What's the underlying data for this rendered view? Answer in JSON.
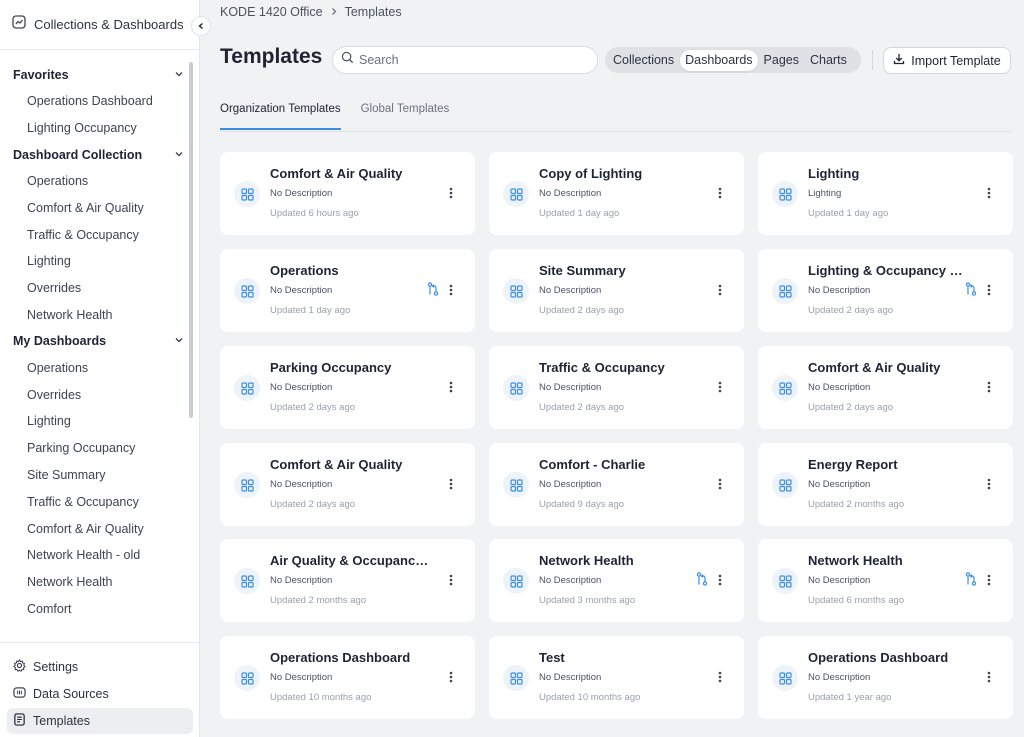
{
  "app": {
    "title": "Collections & Dashboards"
  },
  "sidebar": {
    "sections": [
      {
        "title": "Favorites",
        "items": [
          "Operations Dashboard",
          "Lighting Occupancy"
        ]
      },
      {
        "title": "Dashboard Collection",
        "items": [
          "Operations",
          "Comfort & Air Quality",
          "Traffic & Occupancy",
          "Lighting",
          "Overrides",
          "Network Health"
        ]
      },
      {
        "title": "My Dashboards",
        "items": [
          "Operations",
          "Overrides",
          "Lighting",
          "Parking Occupancy",
          "Site Summary",
          "Traffic & Occupancy",
          "Comfort & Air Quality",
          "Network Health - old",
          "Network Health",
          "Comfort"
        ]
      }
    ],
    "bottom": [
      {
        "label": "Settings",
        "icon": "gear-icon"
      },
      {
        "label": "Data Sources",
        "icon": "data-sources-icon"
      },
      {
        "label": "Templates",
        "icon": "templates-icon",
        "active": true
      }
    ]
  },
  "breadcrumb": [
    "KODE 1420 Office",
    "Templates"
  ],
  "page": {
    "title": "Templates"
  },
  "search": {
    "placeholder": "Search",
    "value": ""
  },
  "filters": [
    {
      "label": "Collections",
      "active": false
    },
    {
      "label": "Dashboards",
      "active": true
    },
    {
      "label": "Pages",
      "active": false
    },
    {
      "label": "Charts",
      "active": false
    }
  ],
  "import_label": "Import Template",
  "tabs": [
    {
      "label": "Organization Templates",
      "active": true
    },
    {
      "label": "Global Templates",
      "active": false
    }
  ],
  "colors": {
    "accent": "#3a8ee6",
    "icon": "#3a8ee6"
  },
  "cards": [
    {
      "title": "Comfort & Air Quality",
      "description": "No Description",
      "updated": "Updated 6 hours ago",
      "merge": false
    },
    {
      "title": "Copy of Lighting",
      "description": "No Description",
      "updated": "Updated 1 day ago",
      "merge": false
    },
    {
      "title": "Lighting",
      "description": "Lighting",
      "updated": "Updated 1 day ago",
      "merge": false
    },
    {
      "title": "Operations",
      "description": "No Description",
      "updated": "Updated 1 day ago",
      "merge": true
    },
    {
      "title": "Site Summary",
      "description": "No Description",
      "updated": "Updated 2 days ago",
      "merge": false
    },
    {
      "title": "Lighting & Occupancy Dashboard",
      "description": "No Description",
      "updated": "Updated 2 days ago",
      "merge": true
    },
    {
      "title": "Parking Occupancy",
      "description": "No Description",
      "updated": "Updated 2 days ago",
      "merge": false
    },
    {
      "title": "Traffic & Occupancy",
      "description": "No Description",
      "updated": "Updated 2 days ago",
      "merge": false
    },
    {
      "title": "Comfort & Air Quality",
      "description": "No Description",
      "updated": "Updated 2 days ago",
      "merge": false
    },
    {
      "title": "Comfort & Air Quality",
      "description": "No Description",
      "updated": "Updated 2 days ago",
      "merge": false
    },
    {
      "title": "Comfort - Charlie",
      "description": "No Description",
      "updated": "Updated 9 days ago",
      "merge": false
    },
    {
      "title": "Energy Report",
      "description": "No Description",
      "updated": "Updated 2 months ago",
      "merge": false
    },
    {
      "title": "Air Quality & Occupancy Dashboard",
      "description": "No Description",
      "updated": "Updated 2 months ago",
      "merge": false
    },
    {
      "title": "Network Health",
      "description": "No Description",
      "updated": "Updated 3 months ago",
      "merge": true
    },
    {
      "title": "Network Health",
      "description": "No Description",
      "updated": "Updated 6 months ago",
      "merge": true
    },
    {
      "title": "Operations Dashboard",
      "description": "No Description",
      "updated": "Updated 10 months ago",
      "merge": false
    },
    {
      "title": "Test",
      "description": "No Description",
      "updated": "Updated 10 months ago",
      "merge": false
    },
    {
      "title": "Operations Dashboard",
      "description": "No Description",
      "updated": "Updated 1 year ago",
      "merge": false
    }
  ]
}
